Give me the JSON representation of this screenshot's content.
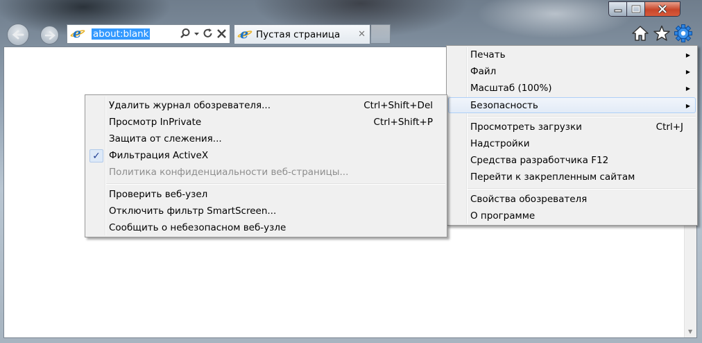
{
  "window": {
    "minimize_icon": "minimize-icon",
    "maximize_icon": "maximize-icon",
    "close_icon": "close-icon"
  },
  "nav": {
    "back_icon": "back-arrow-icon",
    "forward_icon": "forward-arrow-icon"
  },
  "address": {
    "url": "about:blank",
    "icons": [
      "search-icon",
      "dropdown-icon",
      "refresh-icon",
      "stop-icon"
    ]
  },
  "tab": {
    "title": "Пустая страница",
    "close": "✕"
  },
  "toolbar": {
    "icons": [
      "home-icon",
      "favorites-star-icon",
      "tools-gear-icon"
    ]
  },
  "tools_menu": {
    "items": [
      {
        "label": "Печать",
        "submenu": true
      },
      {
        "label": "Файл",
        "submenu": true
      },
      {
        "label": "Масштаб (100%)",
        "submenu": true
      },
      {
        "label": "Безопасность",
        "submenu": true,
        "highlighted": true
      },
      {
        "label": "Просмотреть загрузки",
        "shortcut": "Ctrl+J"
      },
      {
        "label": "Надстройки"
      },
      {
        "label": "Средства разработчика F12"
      },
      {
        "label": "Перейти к закрепленным сайтам"
      },
      {
        "label": "Свойства обозревателя"
      },
      {
        "label": "О программе"
      }
    ]
  },
  "security_menu": {
    "items": [
      {
        "label": "Удалить журнал обозревателя...",
        "shortcut": "Ctrl+Shift+Del"
      },
      {
        "label": "Просмотр InPrivate",
        "shortcut": "Ctrl+Shift+P"
      },
      {
        "label": "Защита от слежения..."
      },
      {
        "label": "Фильтрация ActiveX",
        "checked": true,
        "check_mark": "✓"
      },
      {
        "label": "Политика конфиденциальности веб-страницы...",
        "disabled": true
      },
      {
        "label": "Проверить веб-узел"
      },
      {
        "label": "Отключить фильтр SmartScreen..."
      },
      {
        "label": "Сообщить о небезопасном веб-узле"
      }
    ]
  }
}
